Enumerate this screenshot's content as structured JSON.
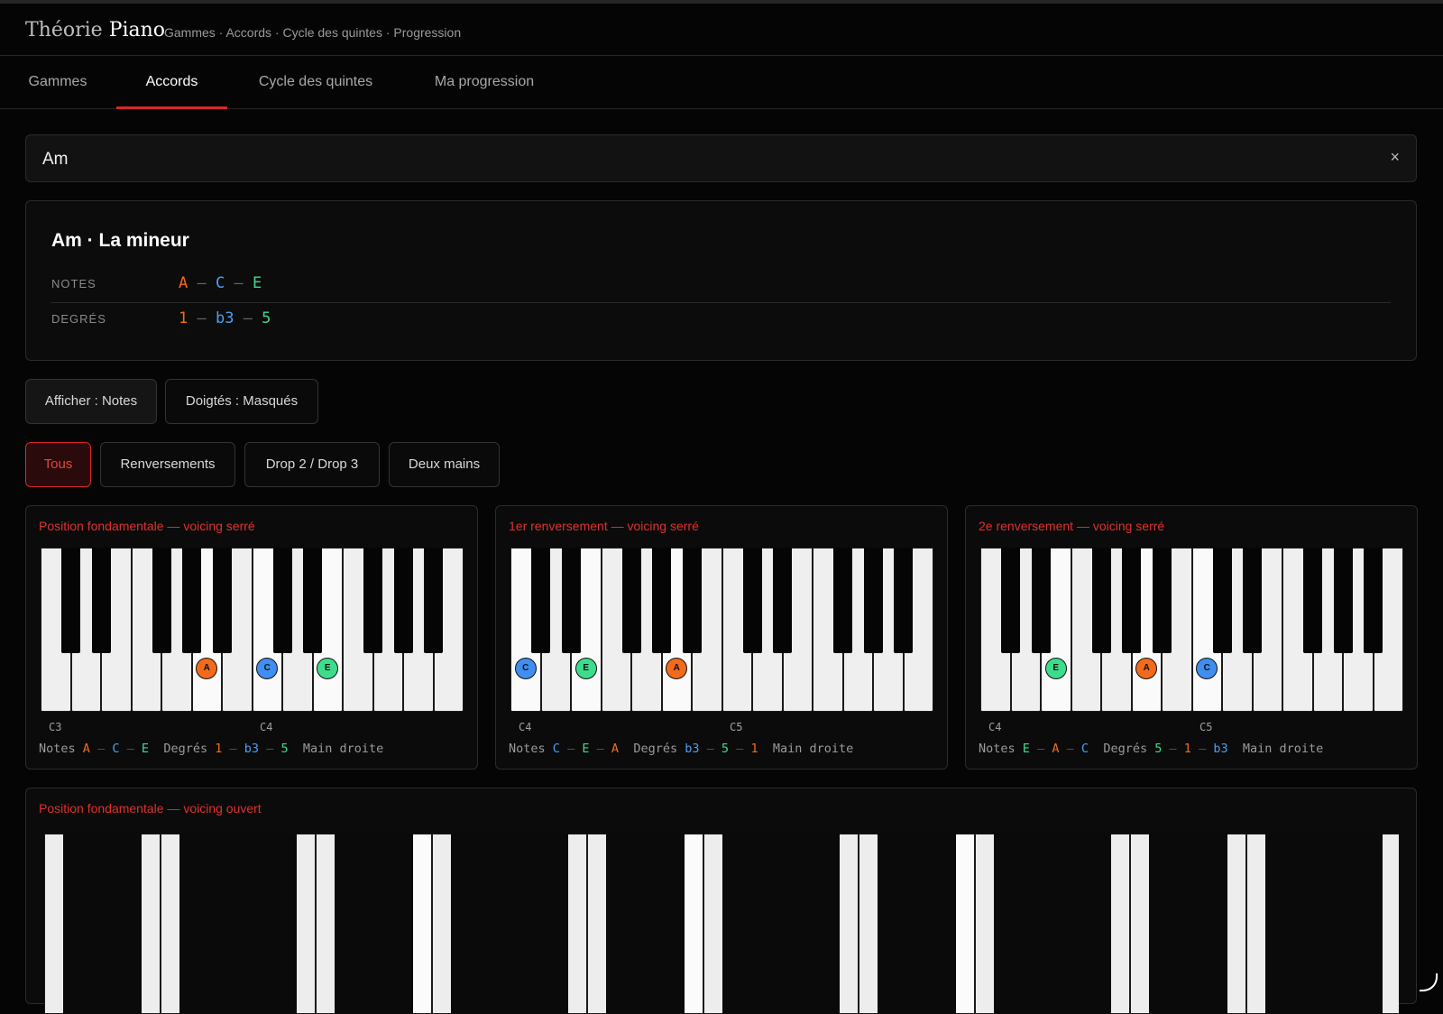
{
  "app": {
    "logo_light": "Théorie",
    "logo_bold": "Piano",
    "subnav": "Gammes · Accords · Cycle des quintes · Progression"
  },
  "tabs": [
    {
      "label": "Gammes",
      "active": false
    },
    {
      "label": "Accords",
      "active": true
    },
    {
      "label": "Cycle des quintes",
      "active": false
    },
    {
      "label": "Ma progression",
      "active": false
    }
  ],
  "search": {
    "value": "Am",
    "clear_label": "×"
  },
  "chord": {
    "title": "Am · La mineur",
    "notes_label": "NOTES",
    "degrees_label": "DEGRÉS",
    "notes": [
      "A",
      "C",
      "E"
    ],
    "degrees": [
      "1",
      "b3",
      "5"
    ]
  },
  "colors": {
    "root": "#f46a1c",
    "third": "#4a9ff5",
    "fifth": "#3ed98f",
    "accent": "#d62828",
    "dot_root": "#f26a1b",
    "dot_third": "#3f8ef0",
    "dot_fifth": "#3ddc8c"
  },
  "toggles": {
    "display": "Afficher : Notes",
    "fingerings": "Doigtés : Masqués"
  },
  "filters": [
    {
      "label": "Tous",
      "active": true
    },
    {
      "label": "Renversements",
      "active": false
    },
    {
      "label": "Drop 2 / Drop 3",
      "active": false
    },
    {
      "label": "Deux mains",
      "active": false
    }
  ],
  "voicings": [
    {
      "title": "Position fondamentale — voicing serré",
      "octaves": [
        "C3",
        "C4"
      ],
      "notes": [
        {
          "n": "A",
          "r": "root"
        },
        {
          "n": "C",
          "r": "third"
        },
        {
          "n": "E",
          "r": "fifth"
        }
      ],
      "degrees": [
        {
          "n": "1",
          "r": "root"
        },
        {
          "n": "b3",
          "r": "third"
        },
        {
          "n": "5",
          "r": "fifth"
        }
      ],
      "hand": "Main droite"
    },
    {
      "title": "1er renversement — voicing serré",
      "octaves": [
        "C4",
        "C5"
      ],
      "notes": [
        {
          "n": "C",
          "r": "third"
        },
        {
          "n": "E",
          "r": "fifth"
        },
        {
          "n": "A",
          "r": "root"
        }
      ],
      "degrees": [
        {
          "n": "b3",
          "r": "third"
        },
        {
          "n": "5",
          "r": "fifth"
        },
        {
          "n": "1",
          "r": "root"
        }
      ],
      "hand": "Main droite"
    },
    {
      "title": "2e renversement — voicing serré",
      "octaves": [
        "C4",
        "C5"
      ],
      "notes": [
        {
          "n": "E",
          "r": "fifth"
        },
        {
          "n": "A",
          "r": "root"
        },
        {
          "n": "C",
          "r": "third"
        }
      ],
      "degrees": [
        {
          "n": "5",
          "r": "fifth"
        },
        {
          "n": "1",
          "r": "root"
        },
        {
          "n": "b3",
          "r": "third"
        }
      ],
      "hand": "Main droite"
    }
  ],
  "footer_labels": {
    "notes": "Notes",
    "degrees": "Degrés"
  },
  "open_voicing": {
    "title": "Position fondamentale — voicing ouvert"
  }
}
